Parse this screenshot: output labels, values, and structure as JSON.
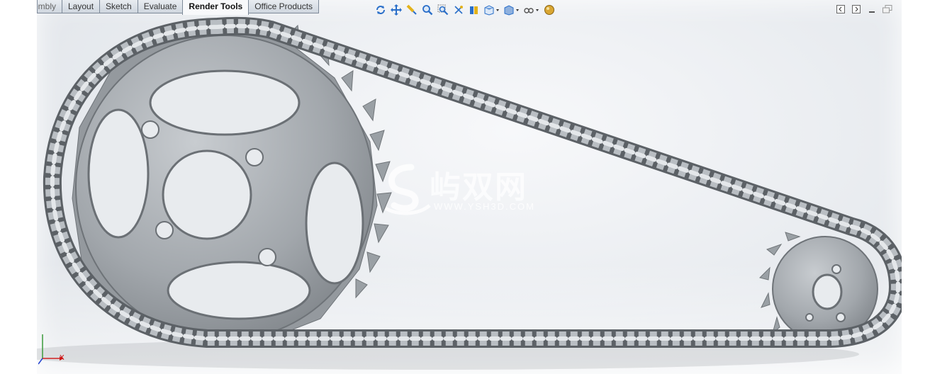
{
  "tabs": [
    {
      "label": "embly",
      "partial": true,
      "active": false
    },
    {
      "label": "Layout",
      "active": false
    },
    {
      "label": "Sketch",
      "active": false
    },
    {
      "label": "Evaluate",
      "active": false
    },
    {
      "label": "Render Tools",
      "active": true
    },
    {
      "label": "Office Products",
      "active": false
    }
  ],
  "toolbar": {
    "icons": [
      "rotate-view-icon",
      "pan-icon",
      "selection-filter-icon",
      "zoom-to-fit-icon",
      "zoom-to-area-icon",
      "previous-view-icon",
      "section-view-icon",
      "view-orientation-icon",
      "display-style-icon",
      "hide-show-items-icon",
      "edit-appearance-icon"
    ]
  },
  "watermark": {
    "title": "屿双网",
    "url": "WWW.YSH3D.COM"
  },
  "triad": {
    "x_label": "X"
  },
  "colors": {
    "tab_border": "#7e8a99",
    "icon_blue": "#2a6fc9",
    "steel": "#9aa0a6"
  }
}
